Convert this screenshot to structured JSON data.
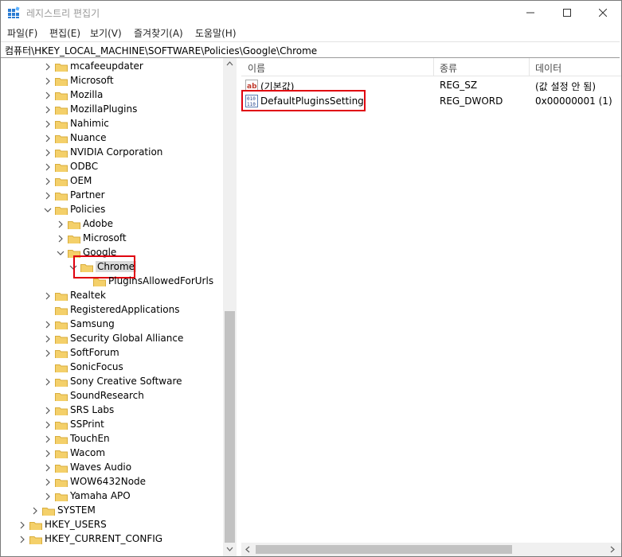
{
  "window": {
    "title": "레지스트리 편집기"
  },
  "menu": [
    "파일(F)",
    "편집(E)",
    "보기(V)",
    "즐겨찾기(A)",
    "도움말(H)"
  ],
  "address": "컴퓨터\\HKEY_LOCAL_MACHINE\\SOFTWARE\\Policies\\Google\\Chrome",
  "tree": [
    {
      "label": "mcafeeupdater",
      "level": 3,
      "exp": "collapsed"
    },
    {
      "label": "Microsoft",
      "level": 3,
      "exp": "collapsed"
    },
    {
      "label": "Mozilla",
      "level": 3,
      "exp": "collapsed"
    },
    {
      "label": "MozillaPlugins",
      "level": 3,
      "exp": "collapsed"
    },
    {
      "label": "Nahimic",
      "level": 3,
      "exp": "collapsed"
    },
    {
      "label": "Nuance",
      "level": 3,
      "exp": "collapsed"
    },
    {
      "label": "NVIDIA Corporation",
      "level": 3,
      "exp": "collapsed"
    },
    {
      "label": "ODBC",
      "level": 3,
      "exp": "collapsed"
    },
    {
      "label": "OEM",
      "level": 3,
      "exp": "collapsed"
    },
    {
      "label": "Partner",
      "level": 3,
      "exp": "collapsed"
    },
    {
      "label": "Policies",
      "level": 3,
      "exp": "expanded"
    },
    {
      "label": "Adobe",
      "level": 4,
      "exp": "collapsed"
    },
    {
      "label": "Microsoft",
      "level": 4,
      "exp": "collapsed"
    },
    {
      "label": "Google",
      "level": 4,
      "exp": "expanded"
    },
    {
      "label": "Chrome",
      "level": 5,
      "exp": "expanded",
      "selected": true
    },
    {
      "label": "PluginsAllowedForUrls",
      "level": 6,
      "exp": "none"
    },
    {
      "label": "Realtek",
      "level": 3,
      "exp": "collapsed"
    },
    {
      "label": "RegisteredApplications",
      "level": 3,
      "exp": "none"
    },
    {
      "label": "Samsung",
      "level": 3,
      "exp": "collapsed"
    },
    {
      "label": "Security Global Alliance",
      "level": 3,
      "exp": "collapsed"
    },
    {
      "label": "SoftForum",
      "level": 3,
      "exp": "collapsed"
    },
    {
      "label": "SonicFocus",
      "level": 3,
      "exp": "none"
    },
    {
      "label": "Sony Creative Software",
      "level": 3,
      "exp": "collapsed"
    },
    {
      "label": "SoundResearch",
      "level": 3,
      "exp": "none"
    },
    {
      "label": "SRS Labs",
      "level": 3,
      "exp": "collapsed"
    },
    {
      "label": "SSPrint",
      "level": 3,
      "exp": "collapsed"
    },
    {
      "label": "TouchEn",
      "level": 3,
      "exp": "collapsed"
    },
    {
      "label": "Wacom",
      "level": 3,
      "exp": "collapsed"
    },
    {
      "label": "Waves Audio",
      "level": 3,
      "exp": "collapsed"
    },
    {
      "label": "WOW6432Node",
      "level": 3,
      "exp": "collapsed"
    },
    {
      "label": "Yamaha APO",
      "level": 3,
      "exp": "collapsed"
    },
    {
      "label": "SYSTEM",
      "level": 2,
      "exp": "collapsed"
    },
    {
      "label": "HKEY_USERS",
      "level": 1,
      "exp": "collapsed"
    },
    {
      "label": "HKEY_CURRENT_CONFIG",
      "level": 1,
      "exp": "collapsed"
    }
  ],
  "list": {
    "columns": [
      "이름",
      "종류",
      "데이터"
    ],
    "rows": [
      {
        "icon": "string-value-icon",
        "name": "(기본값)",
        "type": "REG_SZ",
        "data": "(값 설정 안 됨)"
      },
      {
        "icon": "dword-value-icon",
        "name": "DefaultPluginsSetting",
        "type": "REG_DWORD",
        "data": "0x00000001 (1)"
      }
    ]
  },
  "colors": {
    "highlight": "#e0000f",
    "folder": "#f4d06a",
    "selection": "#d9d9d9"
  }
}
